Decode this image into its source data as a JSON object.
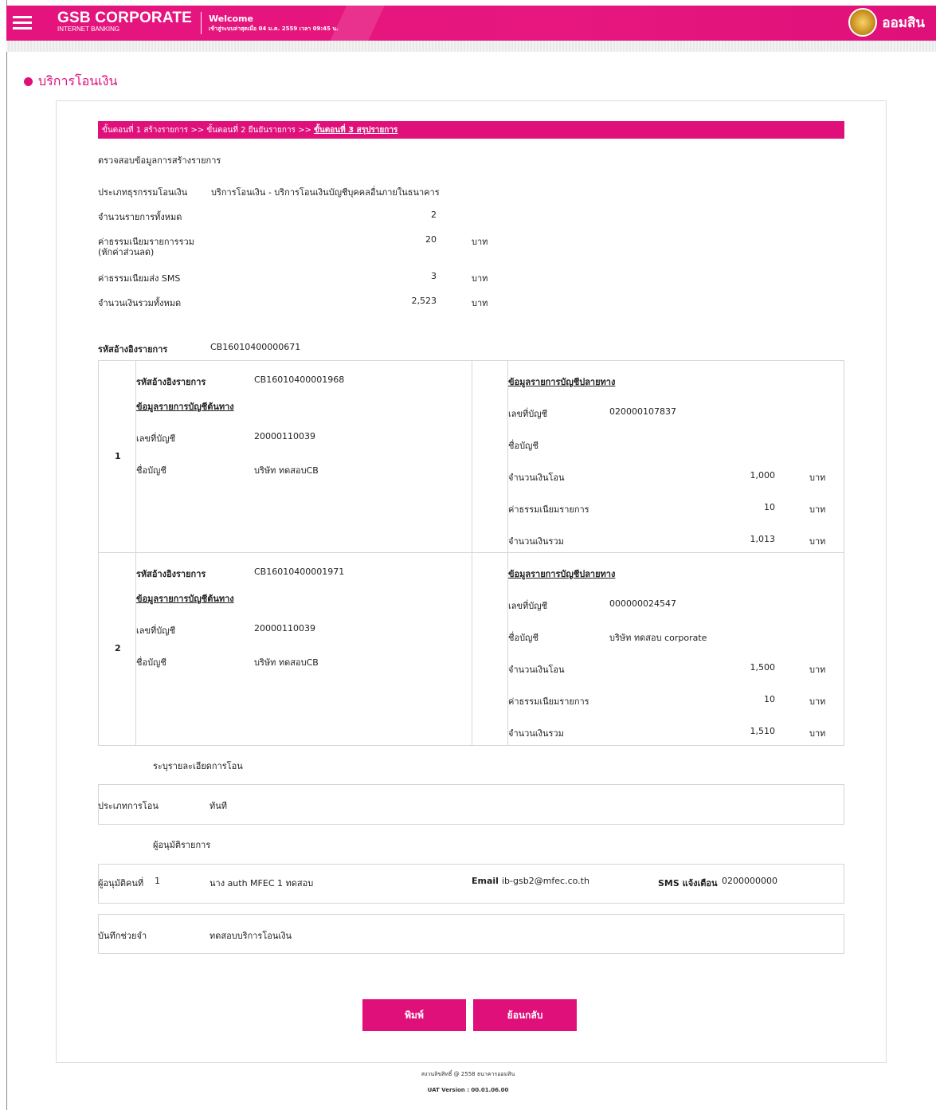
{
  "header": {
    "brand_title": "GSB CORPORATE",
    "brand_subtitle": "INTERNET BANKING",
    "welcome": "Welcome",
    "last_login": "เข้าสู่ระบบล่าสุดเมื่อ 04 ม.ค. 2559 เวลา 09:45 น.",
    "bank_name": "ออมสิน",
    "accent_color": "#e0107a"
  },
  "page_title": "บริการโอนเงิน",
  "steps": {
    "step1": "ขั้นตอนที่ 1 สร้างรายการ",
    "sep1": ">>",
    "step2": "ขั้นตอนที่ 2 ยืนยันรายการ",
    "sep2": ">>",
    "step3": "ขั้นตอนที่ 3 สรุปรายการ"
  },
  "summary": {
    "heading": "ตรวจสอบข้อมูลการสร้างรายการ",
    "rows": [
      {
        "label": "ประเภทธุรกรรมโอนเงิน",
        "value": "บริการโอนเงิน - บริการโอนเงินบัญชีบุคคลอื่นภายในธนาคาร",
        "unit": ""
      },
      {
        "label": "จำนวนรายการทั้งหมด",
        "value": "2",
        "unit": ""
      },
      {
        "label": "ค่าธรรมเนียมรายการรวม",
        "label2": "(หักค่าส่วนลด)",
        "value": "20",
        "unit": "บาท"
      },
      {
        "label": "ค่าธรรมเนียมส่ง SMS",
        "value": "3",
        "unit": "บาท"
      },
      {
        "label": "จำนวนเงินรวมทั้งหมด",
        "value": "2,523",
        "unit": "บาท"
      }
    ],
    "ref_label": "รหัสอ้างอิงรายการ",
    "ref_value": "CB16010400000671"
  },
  "items": [
    {
      "index": "1",
      "ref_label": "รหัสอ้างอิงรายการ",
      "ref": "CB16010400001968",
      "source_heading": "ข้อมูลรายการบัญชีต้นทาง",
      "src_acct_label": "เลขที่บัญชี",
      "src_acct": "20000110039",
      "src_name_label": "ชื่อบัญชี",
      "src_name": "บริษัท ทดสอบCB",
      "dest_heading": "ข้อมูลรายการบัญชีปลายทาง",
      "dst_acct_label": "เลขที่บัญชี",
      "dst_acct": "020000107837",
      "dst_name_label": "ชื่อบัญชี",
      "dst_name": "",
      "amount_label": "จำนวนเงินโอน",
      "amount": "1,000",
      "fee_label": "ค่าธรรมเนียมรายการ",
      "fee": "10",
      "total_label": "จำนวนเงินรวม",
      "total": "1,013",
      "unit": "บาท"
    },
    {
      "index": "2",
      "ref_label": "รหัสอ้างอิงรายการ",
      "ref": "CB16010400001971",
      "source_heading": "ข้อมูลรายการบัญชีต้นทาง",
      "src_acct_label": "เลขที่บัญชี",
      "src_acct": "20000110039",
      "src_name_label": "ชื่อบัญชี",
      "src_name": "บริษัท ทดสอบCB",
      "dest_heading": "ข้อมูลรายการบัญชีปลายทาง",
      "dst_acct_label": "เลขที่บัญชี",
      "dst_acct": "000000024547",
      "dst_name_label": "ชื่อบัญชี",
      "dst_name": "บริษัท ทดสอบ corporate",
      "amount_label": "จำนวนเงินโอน",
      "amount": "1,500",
      "fee_label": "ค่าธรรมเนียมรายการ",
      "fee": "10",
      "total_label": "จำนวนเงินรวม",
      "total": "1,510",
      "unit": "บาท"
    }
  ],
  "transfer_detail": {
    "heading": "ระบุรายละเอียดการโอน",
    "type_label": "ประเภทการโอน",
    "type_value": "ทันที"
  },
  "approvers": {
    "heading": "ผู้อนุมัติรายการ",
    "label": "ผู้อนุมัติคนที่",
    "index": "1",
    "name": "นาง auth MFEC 1 ทดสอบ",
    "email_label": "Email",
    "email": "ib-gsb2@mfec.co.th",
    "sms_label": "SMS แจ้งเตือน",
    "sms": "0200000000"
  },
  "memo": {
    "label": "บันทึกช่วยจำ",
    "value": "ทดสอบบริการโอนเงิน"
  },
  "buttons": {
    "print": "พิมพ์",
    "back": "ย้อนกลับ"
  },
  "footer": {
    "copyright": "สงวนลิขสิทธิ์ @ 2558 ธนาคารออมสิน",
    "version": "UAT Version : 00.01.06.00"
  }
}
